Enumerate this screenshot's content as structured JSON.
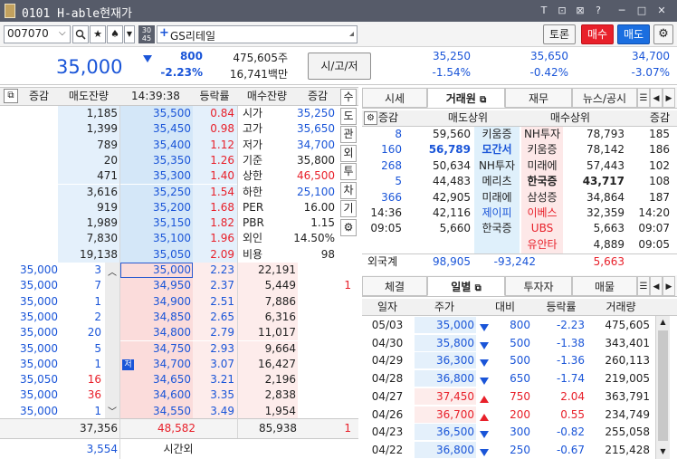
{
  "window": {
    "title": "0101 H-able현재가",
    "controls": [
      "T",
      "⊡",
      "⊠",
      "?",
      "─",
      "□",
      "✕"
    ]
  },
  "toolbar": {
    "code": "007070",
    "name_prefix": "+",
    "name": "GS리테일",
    "badge": "30\n45",
    "btn_toron": "토론",
    "btn_buy": "매수",
    "btn_sell": "매도"
  },
  "quote": {
    "price": "35,000",
    "change": "800",
    "change_pct": "-2.23%",
    "volume": "475,605주",
    "amount": "16,741백만",
    "ohl_label": "시/고/저",
    "open": "35,250",
    "open_pct": "-1.54%",
    "high": "35,650",
    "high_pct": "-0.42%",
    "low": "34,700",
    "low_pct": "-3.07%"
  },
  "orderbook": {
    "headers": [
      "증감",
      "매도잔량",
      "14:39:38",
      "등락률",
      "매수잔량",
      "증감"
    ],
    "asks": [
      {
        "qty": "1,185",
        "price": "35,500",
        "rate": "0.84"
      },
      {
        "qty": "1,399",
        "price": "35,450",
        "rate": "0.98"
      },
      {
        "qty": "789",
        "price": "35,400",
        "rate": "1.12"
      },
      {
        "qty": "20",
        "price": "35,350",
        "rate": "1.26"
      },
      {
        "qty": "471",
        "price": "35,300",
        "rate": "1.40"
      },
      {
        "qty": "3,616",
        "price": "35,250",
        "rate": "1.54",
        "tag": "시"
      },
      {
        "qty": "919",
        "price": "35,200",
        "rate": "1.68"
      },
      {
        "qty": "1,989",
        "price": "35,150",
        "rate": "1.82"
      },
      {
        "qty": "7,830",
        "price": "35,100",
        "rate": "1.96"
      },
      {
        "qty": "19,138",
        "price": "35,050",
        "rate": "2.09"
      }
    ],
    "info": [
      {
        "label": "시가",
        "value": "35,250",
        "color": "blue"
      },
      {
        "label": "고가",
        "value": "35,650",
        "color": "blue"
      },
      {
        "label": "저가",
        "value": "34,700",
        "color": "blue"
      },
      {
        "label": "기준",
        "value": "35,800",
        "color": "dk"
      },
      {
        "label": "상한",
        "value": "46,500",
        "color": "red"
      },
      {
        "label": "하한",
        "value": "25,100",
        "color": "blue"
      },
      {
        "label": "PER",
        "value": "16.00",
        "color": "dk"
      },
      {
        "label": "PBR",
        "value": "1.15",
        "color": "dk"
      },
      {
        "label": "외인",
        "value": "14.50%",
        "color": "dk"
      },
      {
        "label": "비용",
        "value": "98",
        "color": "dk"
      }
    ],
    "bids": [
      {
        "tick": "35,000",
        "tqty": "3",
        "price": "35,000",
        "rate": "2.23",
        "qty": "22,191",
        "chg": ""
      },
      {
        "tick": "35,000",
        "tqty": "7",
        "price": "34,950",
        "rate": "2.37",
        "qty": "5,449",
        "chg": "1"
      },
      {
        "tick": "35,000",
        "tqty": "1",
        "price": "34,900",
        "rate": "2.51",
        "qty": "7,886",
        "chg": ""
      },
      {
        "tick": "35,000",
        "tqty": "2",
        "price": "34,850",
        "rate": "2.65",
        "qty": "6,316",
        "chg": ""
      },
      {
        "tick": "35,000",
        "tqty": "20",
        "price": "34,800",
        "rate": "2.79",
        "qty": "11,017",
        "chg": ""
      },
      {
        "tick": "35,000",
        "tqty": "5",
        "price": "34,750",
        "rate": "2.93",
        "qty": "9,664",
        "chg": ""
      },
      {
        "tick": "35,000",
        "tqty": "1",
        "price": "34,700",
        "rate": "3.07",
        "qty": "16,427",
        "chg": "",
        "tag": "저"
      },
      {
        "tick": "35,050",
        "tqty": "16",
        "price": "34,650",
        "rate": "3.21",
        "qty": "2,196",
        "chg": ""
      },
      {
        "tick": "35,000",
        "tqty": "36",
        "price": "34,600",
        "rate": "3.35",
        "qty": "2,838",
        "chg": ""
      },
      {
        "tick": "35,000",
        "tqty": "1",
        "price": "34,550",
        "rate": "3.49",
        "qty": "1,954",
        "chg": ""
      }
    ],
    "total_ask": "37,356",
    "total_diff": "48,582",
    "total_bid": "85,938",
    "total_chg": "1",
    "after_qty": "3,554",
    "after_label": "시간외"
  },
  "side_buttons": [
    "수",
    "도",
    "관",
    "외",
    "투",
    "차",
    "기",
    "⚙"
  ],
  "broker": {
    "tabs": [
      "시세",
      "거래원",
      "재무",
      "뉴스/공시"
    ],
    "headers": {
      "chg": "증감",
      "sell": "매도상위",
      "buy": "매수상위",
      "chg2": "증감"
    },
    "rows": [
      {
        "sc": "8",
        "sq": "59,560",
        "sn": "키움증",
        "bn": "NH투자",
        "bq": "78,793",
        "bc": "185"
      },
      {
        "sc": "160",
        "sq": "56,789",
        "sn": "모간서",
        "bn": "키움증",
        "bq": "78,142",
        "bc": "186",
        "sbold": true
      },
      {
        "sc": "268",
        "sq": "50,634",
        "sn": "NH투자",
        "bn": "미래에",
        "bq": "57,443",
        "bc": "102"
      },
      {
        "sc": "5",
        "sq": "44,483",
        "sn": "메리츠",
        "bn": "한국증",
        "bq": "43,717",
        "bc": "108",
        "bbold": true
      },
      {
        "sc": "366",
        "sq": "42,905",
        "sn": "미래에",
        "bn": "삼성증",
        "bq": "34,864",
        "bc": "187"
      },
      {
        "sc": "14:36",
        "sq": "42,116",
        "sn": "제이피",
        "bn": "이베스",
        "bq": "32,359",
        "bc": "14:20"
      },
      {
        "sc": "09:05",
        "sq": "5,660",
        "sn": "한국증",
        "bn": "UBS",
        "bq": "5,663",
        "bc": "09:07"
      },
      {
        "sc": "",
        "sq": "",
        "sn": "",
        "bn": "유안타",
        "bq": "4,889",
        "bc": "09:05"
      }
    ],
    "foreign_label": "외국계",
    "foreign_sell": "98,905",
    "foreign_diff": "-93,242",
    "foreign_buy": "5,663"
  },
  "daily": {
    "tabs": [
      "체결",
      "일별",
      "투자자",
      "매물"
    ],
    "headers": [
      "일자",
      "주가",
      "대비",
      "등락률",
      "거래량"
    ],
    "rows": [
      {
        "date": "05/03",
        "price": "35,000",
        "dir": "down",
        "diff": "800",
        "rate": "-2.23",
        "vol": "475,605"
      },
      {
        "date": "04/30",
        "price": "35,800",
        "dir": "down",
        "diff": "500",
        "rate": "-1.38",
        "vol": "343,401"
      },
      {
        "date": "04/29",
        "price": "36,300",
        "dir": "down",
        "diff": "500",
        "rate": "-1.36",
        "vol": "260,113"
      },
      {
        "date": "04/28",
        "price": "36,800",
        "dir": "down",
        "diff": "650",
        "rate": "-1.74",
        "vol": "219,005"
      },
      {
        "date": "04/27",
        "price": "37,450",
        "dir": "up",
        "diff": "750",
        "rate": "2.04",
        "vol": "363,791"
      },
      {
        "date": "04/26",
        "price": "36,700",
        "dir": "up",
        "diff": "200",
        "rate": "0.55",
        "vol": "234,749"
      },
      {
        "date": "04/23",
        "price": "36,500",
        "dir": "down",
        "diff": "300",
        "rate": "-0.82",
        "vol": "255,058"
      },
      {
        "date": "04/22",
        "price": "36,800",
        "dir": "down",
        "diff": "250",
        "rate": "-0.67",
        "vol": "215,428"
      }
    ]
  }
}
